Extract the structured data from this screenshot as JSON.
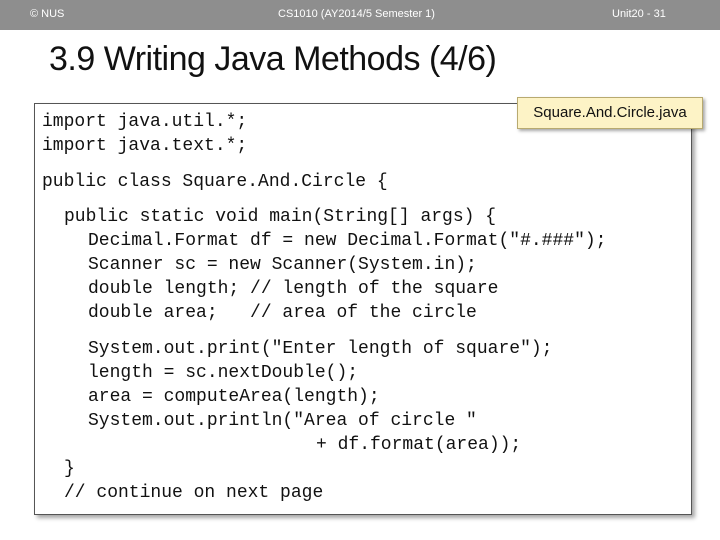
{
  "header": {
    "left": "© NUS",
    "center": "CS1010 (AY2014/5 Semester 1)",
    "right": "Unit20 - 31"
  },
  "slide": {
    "title": "3.9 Writing Java Methods (4/6)",
    "filename": "Square.And.Circle.java"
  },
  "code": {
    "lines": [
      "import java.util.*;",
      "import java.text.*;",
      "public class Square.And.Circle {",
      "public static void main(String[] args) {",
      "Decimal.Format df = new Decimal.Format(\"#.###\");",
      "Scanner sc = new Scanner(System.in);",
      "double length; // length of the square",
      "double area;   // area of the circle",
      "System.out.print(\"Enter length of square\");",
      "length = sc.nextDouble();",
      "area = computeArea(length);",
      "System.out.println(\"Area of circle \"",
      "+ df.format(area));",
      "}",
      "// continue on next page"
    ]
  }
}
